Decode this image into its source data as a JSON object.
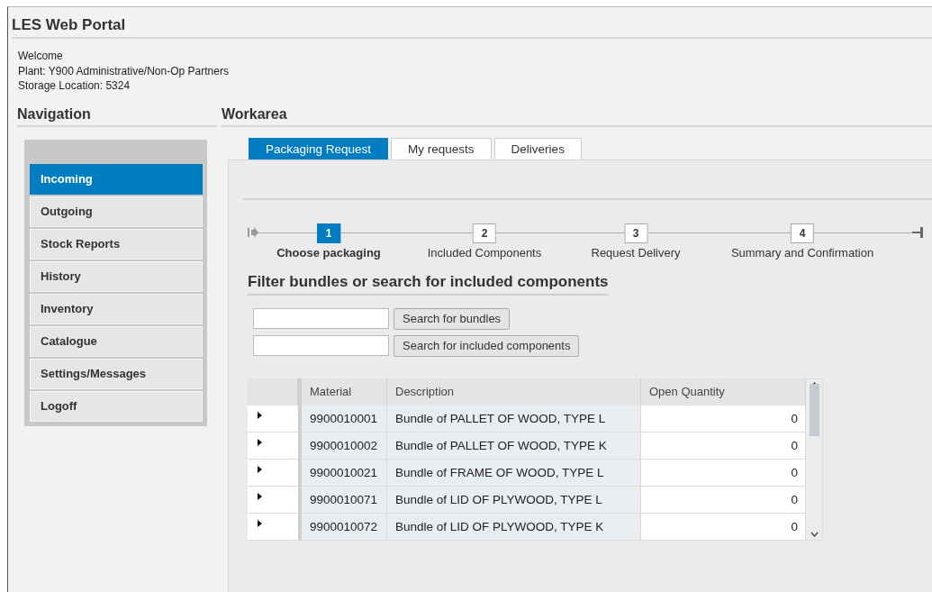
{
  "portal": {
    "title": "LES Web Portal"
  },
  "info": [
    "Welcome",
    "Plant: Y900 Administrative/Non-Op Partners",
    "Storage Location: 5324"
  ],
  "navigation": {
    "title": "Navigation",
    "items": [
      {
        "label": "Incoming",
        "selected": true
      },
      {
        "label": "Outgoing",
        "selected": false
      },
      {
        "label": "Stock Reports",
        "selected": false
      },
      {
        "label": "History",
        "selected": false
      },
      {
        "label": "Inventory",
        "selected": false
      },
      {
        "label": "Catalogue",
        "selected": false
      },
      {
        "label": "Settings/Messages",
        "selected": false
      },
      {
        "label": "Logoff",
        "selected": false
      }
    ]
  },
  "workarea": {
    "title": "Workarea",
    "tabs": [
      {
        "label": "Packaging Request",
        "selected": true
      },
      {
        "label": "My requests",
        "selected": false
      },
      {
        "label": "Deliveries",
        "selected": false
      }
    ],
    "steps": [
      {
        "number": "1",
        "label": "Choose packaging",
        "selected": true
      },
      {
        "number": "2",
        "label": "Included Components",
        "selected": false
      },
      {
        "number": "3",
        "label": "Request Delivery",
        "selected": false
      },
      {
        "number": "4",
        "label": "Summary and Confirmation",
        "selected": false
      }
    ],
    "heading": "Filter bundles or search for included components",
    "searches": [
      {
        "button": "Search for bundles"
      },
      {
        "button": "Search for included components"
      }
    ],
    "table": {
      "columns": [
        "Material",
        "Description",
        "Open Quantity"
      ],
      "rows": [
        {
          "material": "9900010001",
          "description": "Bundle of PALLET OF WOOD, TYPE L",
          "open_quantity": "0"
        },
        {
          "material": "9900010002",
          "description": "Bundle of PALLET OF WOOD, TYPE K",
          "open_quantity": "0"
        },
        {
          "material": "9900010021",
          "description": "Bundle of FRAME OF WOOD, TYPE L",
          "open_quantity": "0"
        },
        {
          "material": "9900010071",
          "description": "Bundle of LID OF PLYWOOD, TYPE L",
          "open_quantity": "0"
        },
        {
          "material": "9900010072",
          "description": "Bundle of LID OF PLYWOOD, TYPE K",
          "open_quantity": "0"
        }
      ]
    }
  }
}
